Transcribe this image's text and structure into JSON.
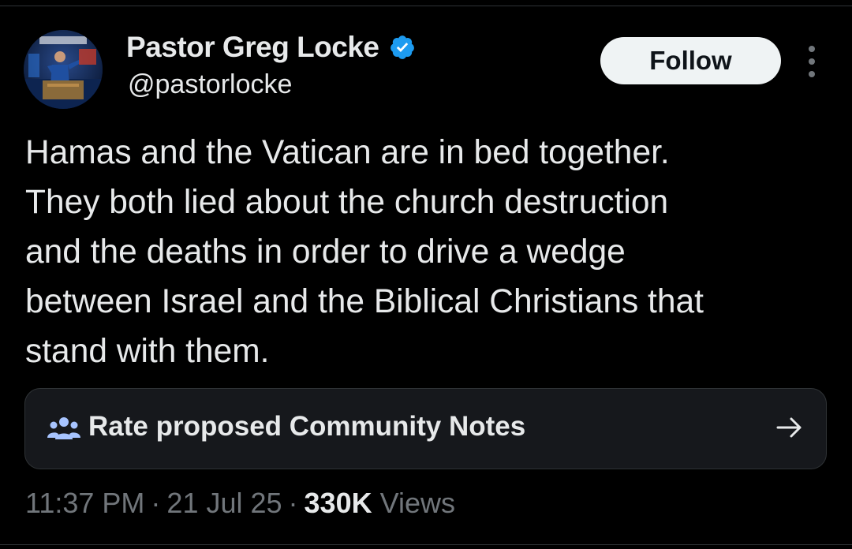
{
  "author": {
    "display_name": "Pastor Greg Locke",
    "handle": "@pastorlocke",
    "verified": true,
    "avatar_icon": "profile-photo",
    "verified_icon": "verified-badge-icon",
    "verified_color": "#1d9bf0"
  },
  "actions": {
    "follow_label": "Follow",
    "more_icon": "more-options-icon"
  },
  "tweet": {
    "text": "Hamas and the Vatican are in bed together.\nThey both lied about the church destruction\nand the deaths in order to drive a wedge\nbetween Israel and the Biblical Christians that\nstand with them."
  },
  "community_notes": {
    "label": "Rate proposed Community Notes",
    "icon": "people-icon",
    "arrow_icon": "arrow-right-icon",
    "icon_color": "#a7c4ff"
  },
  "meta": {
    "time": "11:37 PM",
    "separator": "·",
    "date": "21 Jul 25",
    "views_count": "330K",
    "views_label": "Views"
  },
  "colors": {
    "background": "#000000",
    "text_primary": "#e7e9ea",
    "text_secondary": "#71767b",
    "border": "#2f3336",
    "card_background": "#16181c"
  }
}
